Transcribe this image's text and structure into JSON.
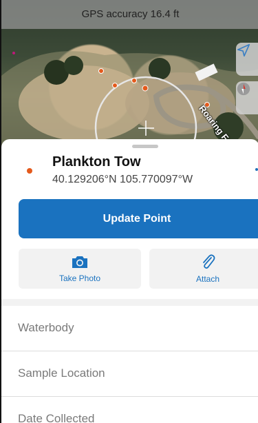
{
  "map": {
    "gps_accuracy": "GPS accuracy 16.4 ft",
    "road_label": "Roaring Fork",
    "locate_icon": "location-arrow-icon",
    "compass_icon": "compass-icon"
  },
  "feature": {
    "title": "Plankton Tow",
    "coordinates": "40.129206°N  105.770097°W",
    "symbol_color": "#e45a1c"
  },
  "actions": {
    "update_label": "Update Point",
    "take_photo_label": "Take Photo",
    "attach_label": "Attach"
  },
  "fields": [
    {
      "label": "Waterbody"
    },
    {
      "label": "Sample Location"
    },
    {
      "label": "Date Collected"
    }
  ],
  "colors": {
    "accent": "#1a72bf",
    "point": "#e45a1c"
  }
}
